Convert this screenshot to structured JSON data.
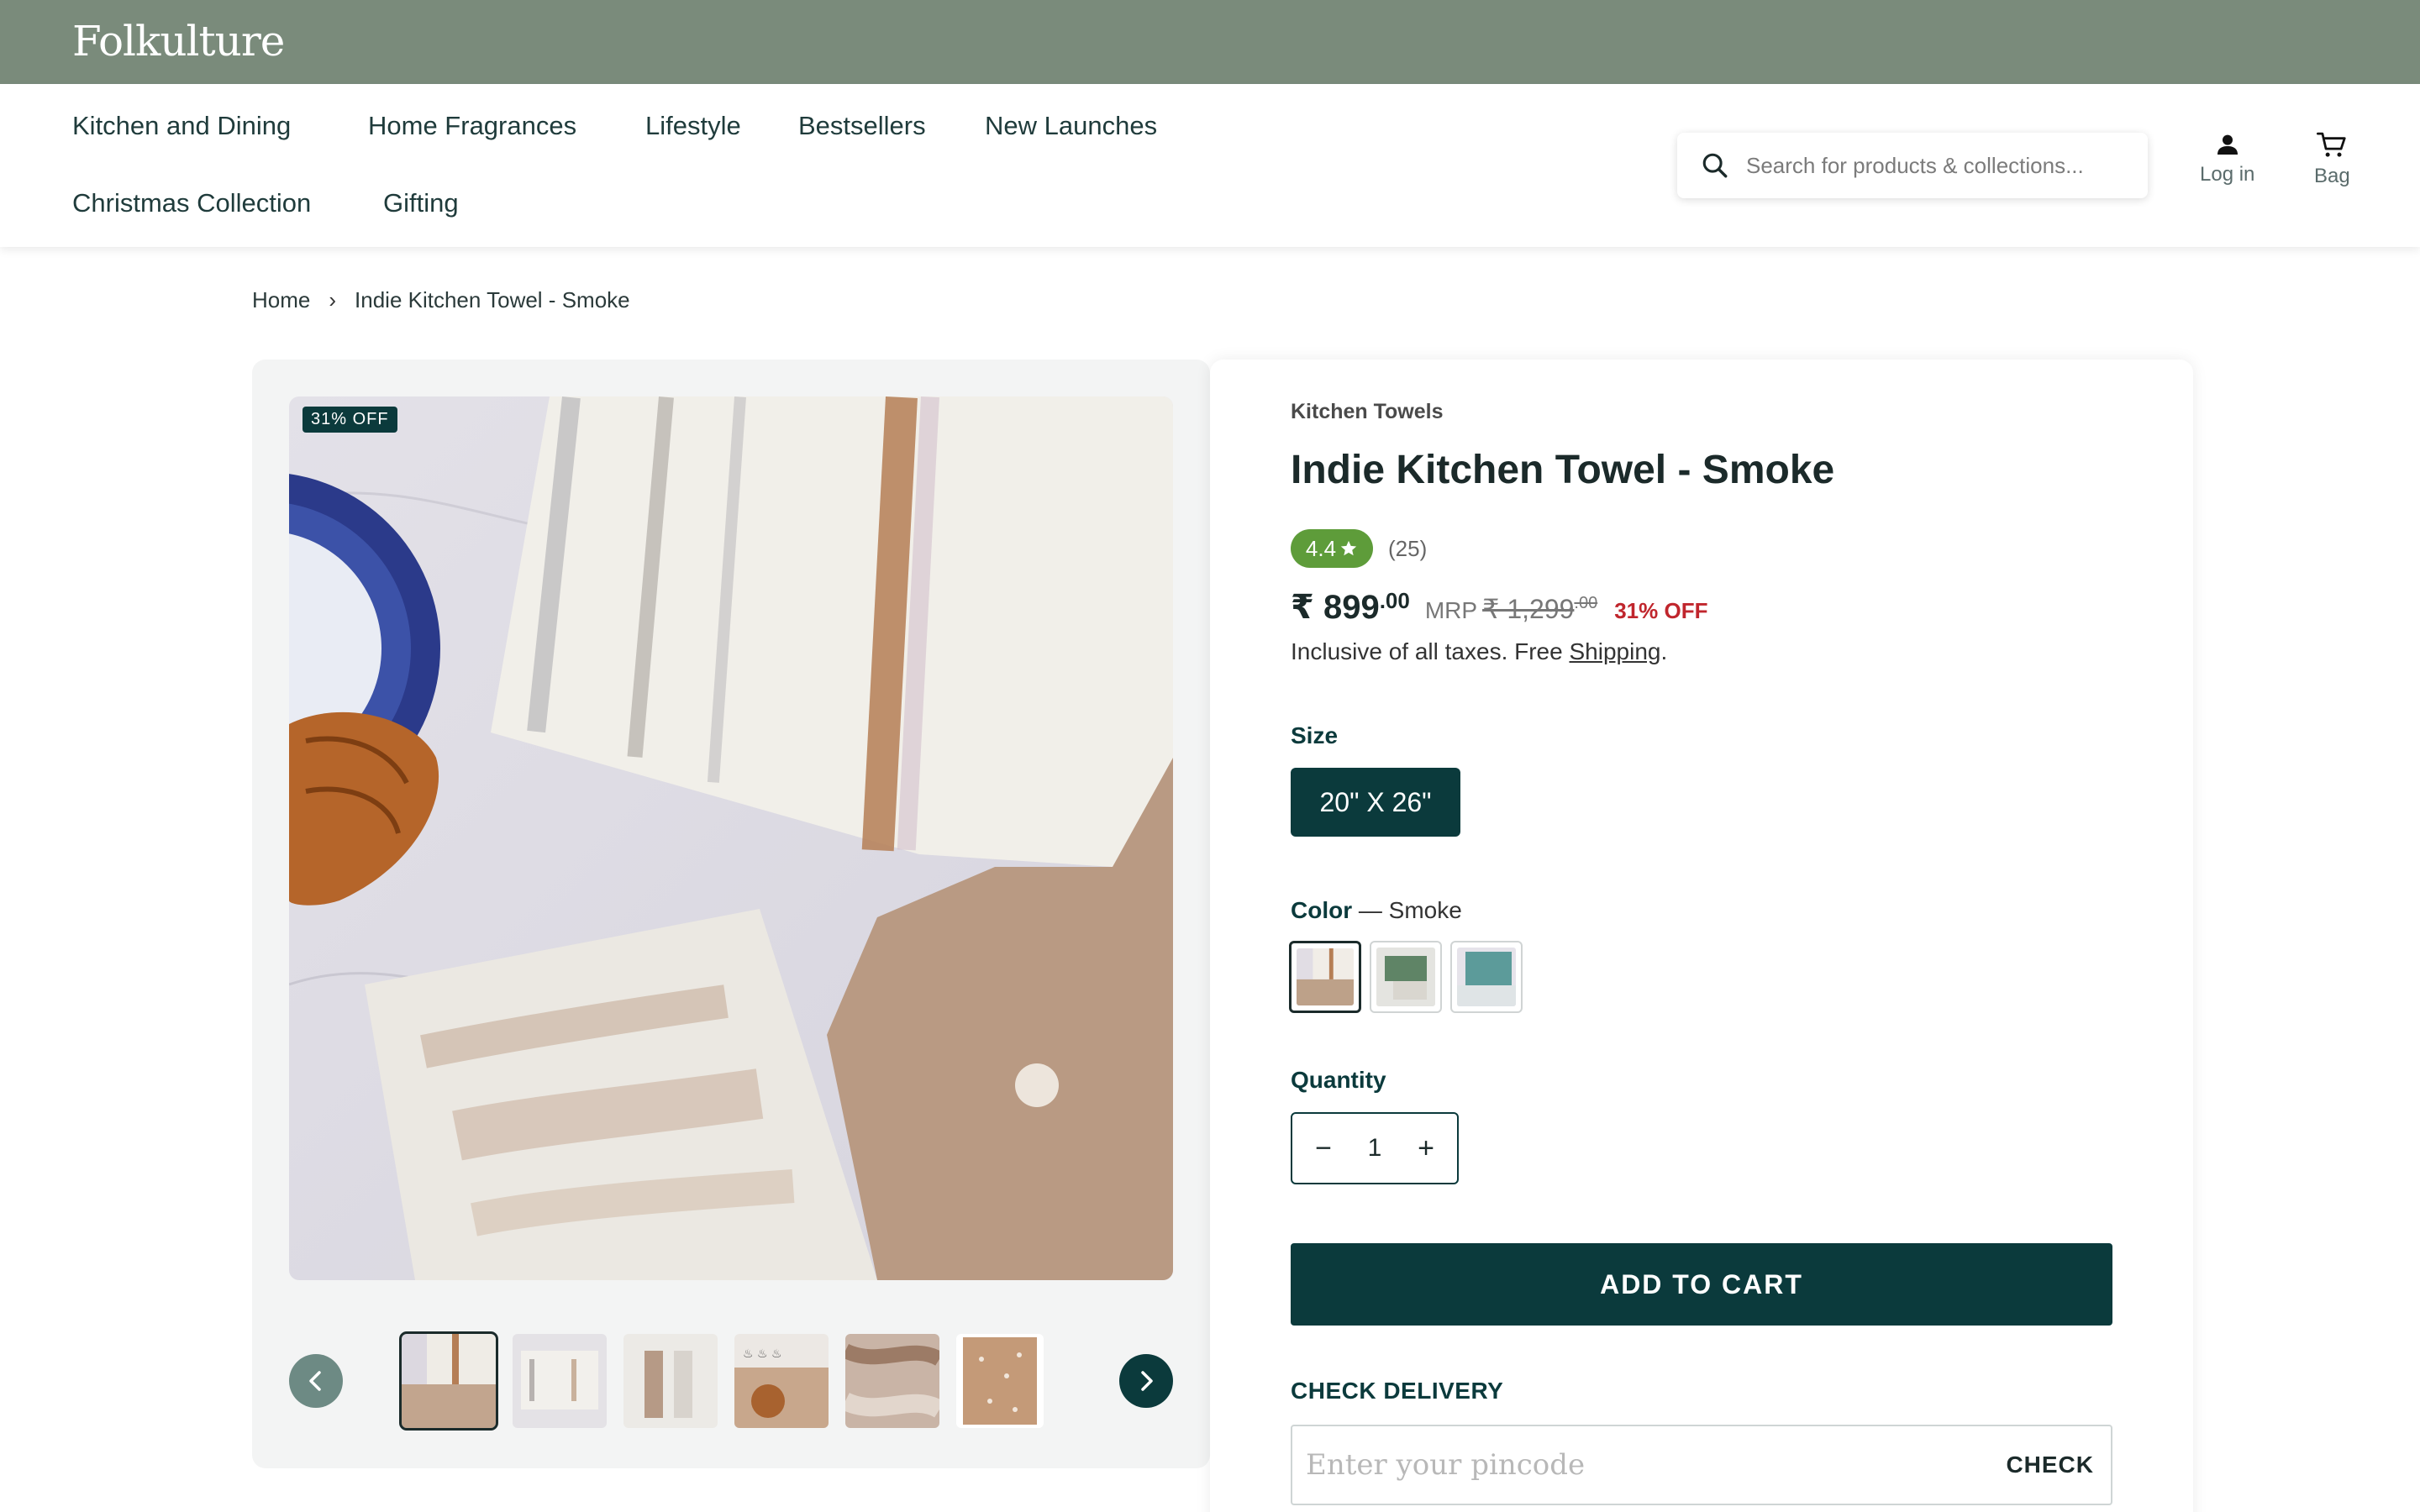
{
  "brand": {
    "name": "Folkulture"
  },
  "nav": {
    "items": [
      {
        "label": "Kitchen and Dining"
      },
      {
        "label": "Home Fragrances"
      },
      {
        "label": "Lifestyle"
      },
      {
        "label": "Bestsellers"
      },
      {
        "label": "New Launches"
      },
      {
        "label": "Christmas Collection"
      },
      {
        "label": "Gifting"
      }
    ],
    "search_placeholder": "Search for products & collections...",
    "login_label": "Log in",
    "bag_label": "Bag"
  },
  "breadcrumb": {
    "home": "Home",
    "separator": "›",
    "current": "Indie Kitchen Towel - Smoke"
  },
  "gallery": {
    "discount_badge": "31% OFF",
    "thumbnail_count": 6,
    "active_thumbnail": 1
  },
  "product": {
    "category": "Kitchen Towels",
    "title": "Indie Kitchen Towel - Smoke",
    "rating": "4.4",
    "review_count": "(25)",
    "price_whole": "₹ 899",
    "price_decimal": ".00",
    "mrp_label": "MRP",
    "mrp_whole": "₹ 1,299",
    "mrp_decimal": ".00",
    "discount": "31% OFF",
    "tax_text": "Inclusive of all taxes. Free ",
    "shipping_link": "Shipping",
    "tax_suffix": "."
  },
  "size": {
    "label": "Size",
    "selected": "20\" X 26\""
  },
  "color": {
    "label": "Color",
    "separator": " — ",
    "selected": "Smoke",
    "swatches": [
      "Smoke",
      "Green",
      "Teal"
    ]
  },
  "quantity": {
    "label": "Quantity",
    "value": "1",
    "minus": "−",
    "plus": "+"
  },
  "actions": {
    "add_to_cart": "ADD TO CART"
  },
  "delivery": {
    "heading": "CHECK DELIVERY",
    "placeholder": "Enter your pincode",
    "check_label": "CHECK"
  },
  "colors": {
    "brand_bar": "#7a8b7b",
    "primary": "#0b3a3c",
    "rating_green": "#5e9c3a",
    "discount_red": "#c0262d"
  }
}
